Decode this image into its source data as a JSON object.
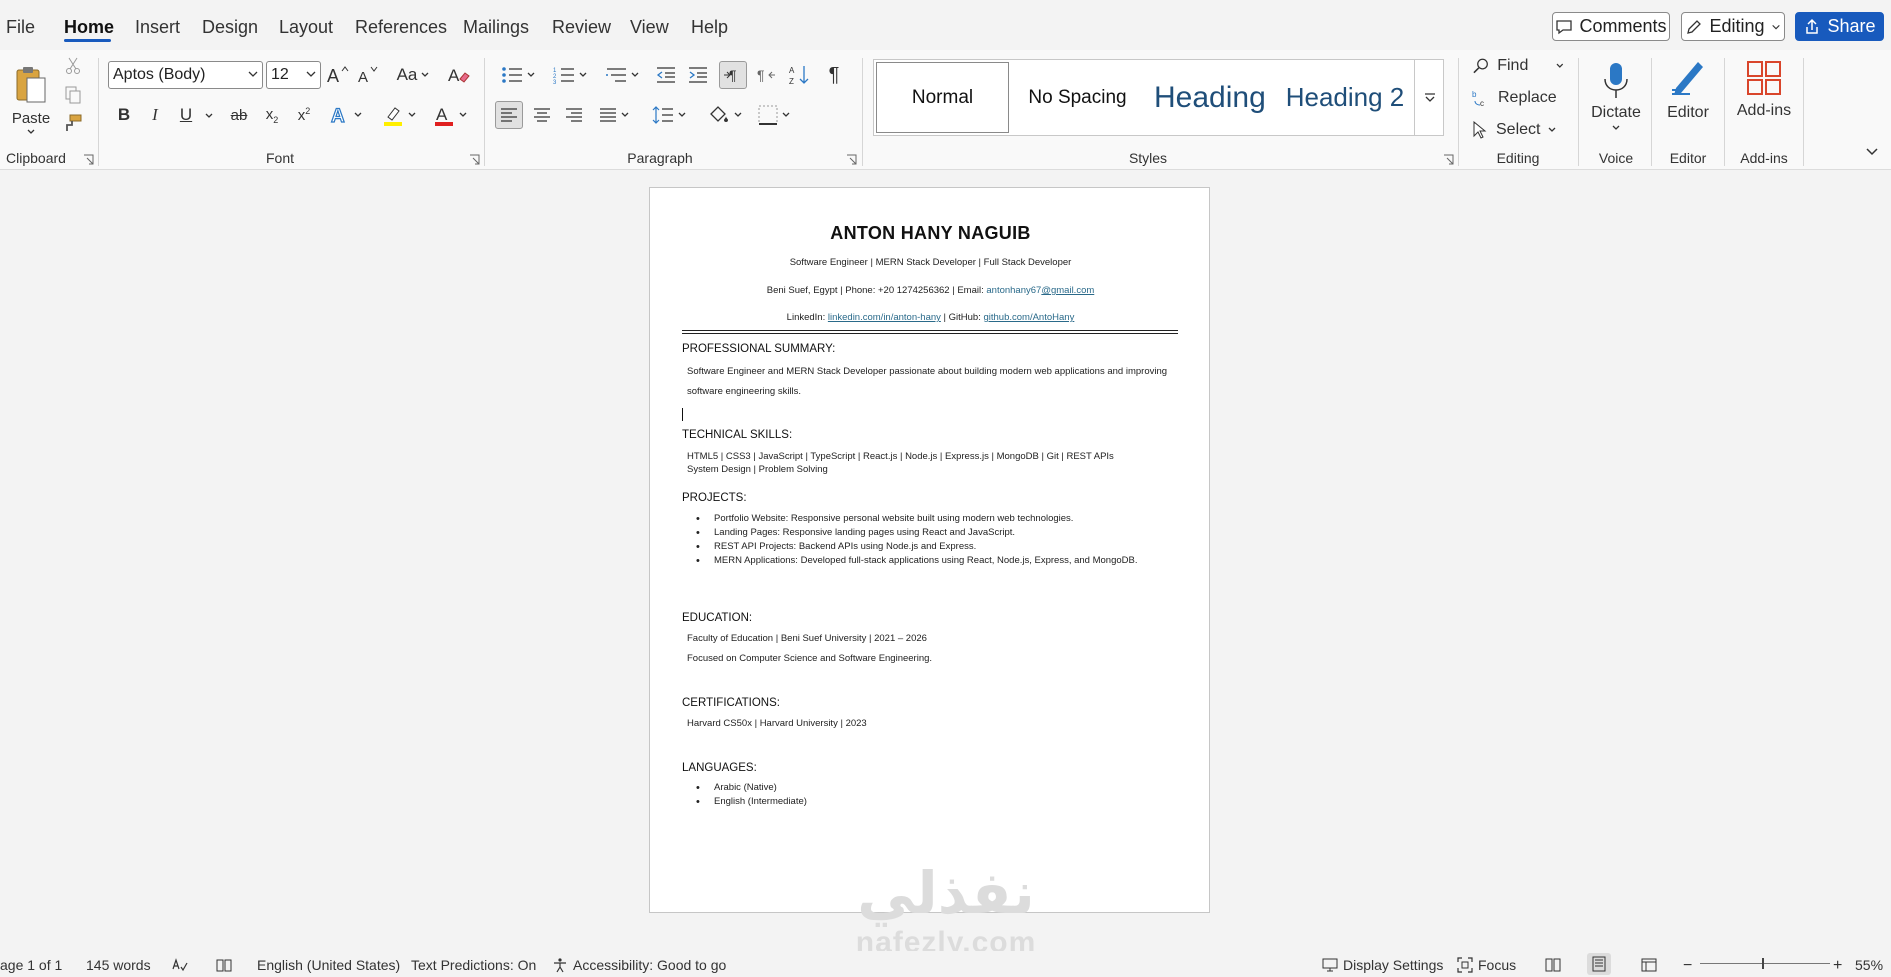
{
  "menu": {
    "items": [
      "File",
      "Home",
      "Insert",
      "Design",
      "Layout",
      "References",
      "Mailings",
      "Review",
      "View",
      "Help"
    ],
    "active": "Home",
    "comments_label": "Comments",
    "editing_label": "Editing",
    "share_label": "Share"
  },
  "ribbon": {
    "clipboard": {
      "paste_label": "Paste",
      "group_label": "Clipboard"
    },
    "font": {
      "font_name": "Aptos (Body)",
      "font_size": "12",
      "group_label": "Font",
      "change_case": "Aa"
    },
    "paragraph": {
      "group_label": "Paragraph"
    },
    "styles": {
      "group_label": "Styles",
      "cards": [
        "Normal",
        "No Spacing",
        "Heading 1",
        "Heading 2"
      ]
    },
    "editing": {
      "find_label": "Find",
      "replace_label": "Replace",
      "select_label": "Select",
      "group_label": "Editing"
    },
    "voice": {
      "dictate_label": "Dictate",
      "group_label": "Voice"
    },
    "editor": {
      "editor_label": "Editor",
      "group_label": "Editor"
    },
    "addins": {
      "addins_label": "Add-ins",
      "group_label": "Add-ins"
    }
  },
  "document": {
    "name": "ANTON HANY NAGUIB",
    "tagline": "Software Engineer | MERN Stack Developer | Full Stack Developer",
    "contact_prefix": "Beni Suef, Egypt | Phone: +20 1274256362 | Email: ",
    "email_user": "antonhany67",
    "email_domain": "@gmail.com",
    "linkedin_prefix": "LinkedIn: ",
    "linkedin_url": "linkedin.com/in/anton-hany",
    "github_prefix": " | GitHub: ",
    "github_url": "github.com/AntoHany",
    "summary_heading": "PROFESSIONAL SUMMARY:",
    "summary_text": "Software Engineer and MERN Stack Developer passionate about building modern web applications and improving software engineering skills.",
    "skills_heading": "TECHNICAL SKILLS:",
    "skills_line1": "HTML5 | CSS3 | JavaScript | TypeScript | React.js | Node.js | Express.js | MongoDB | Git | REST APIs",
    "skills_line2": "System Design | Problem Solving",
    "projects_heading": "PROJECTS:",
    "projects": [
      "Portfolio Website: Responsive personal website built using modern web technologies.",
      "Landing Pages: Responsive landing pages using React and JavaScript.",
      "REST API Projects: Backend APIs using Node.js and Express.",
      "MERN Applications: Developed full-stack applications using React, Node.js, Express, and MongoDB."
    ],
    "education_heading": "EDUCATION:",
    "education_line1": "Faculty of Education | Beni Suef University | 2021 – 2026",
    "education_line2": "Focused on Computer Science and Software Engineering.",
    "certifications_heading": "CERTIFICATIONS:",
    "certifications_line1": "Harvard CS50x | Harvard University | 2023",
    "languages_heading": "LANGUAGES:",
    "languages": [
      "Arabic (Native)",
      "English (Intermediate)"
    ]
  },
  "watermark": {
    "arabic": "نفذلي",
    "latin": "nafezly.com"
  },
  "status": {
    "page": "age 1 of 1",
    "words": "145 words",
    "language": "English (United States)",
    "predictions": "Text Predictions: On",
    "accessibility": "Accessibility: Good to go",
    "display_settings": "Display Settings",
    "focus": "Focus",
    "zoom": "55%"
  },
  "colors": {
    "accent": "#185abd",
    "heading_blue": "#1f4e79",
    "link": "#2a6a8a"
  }
}
